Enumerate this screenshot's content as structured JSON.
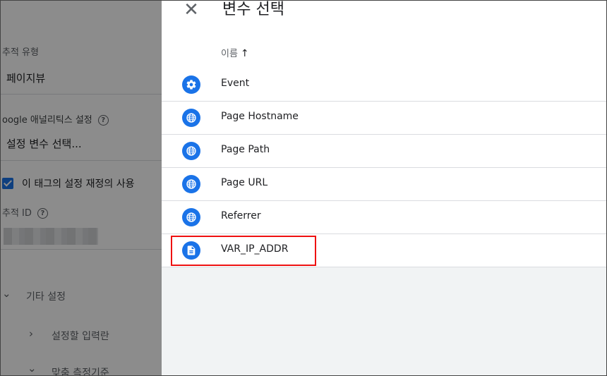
{
  "background_form": {
    "tracking_type_label": "추적 유형",
    "tracking_type_value": "페이지뷰",
    "ga_settings_label": "oogle 애널리틱스 설정",
    "select_settings_variable": "설정 변수 선택...",
    "override_checkbox_label": "이 태그의 설정 재정의 사용",
    "override_checked": true,
    "tracking_id_label": "추적 ID",
    "more_settings": "기타 설정",
    "fields_to_set": "설정할 입력란",
    "custom_dimensions": "맞춤 측정기준"
  },
  "drawer": {
    "title": "변수 선택",
    "column_header": "이름",
    "sort_indicator": "↑",
    "variables": [
      {
        "name": "Event",
        "icon": "gear-icon"
      },
      {
        "name": "Page Hostname",
        "icon": "globe-icon"
      },
      {
        "name": "Page Path",
        "icon": "globe-icon"
      },
      {
        "name": "Page URL",
        "icon": "globe-icon"
      },
      {
        "name": "Referrer",
        "icon": "globe-icon"
      },
      {
        "name": "VAR_IP_ADDR",
        "icon": "document-icon",
        "highlighted": true
      }
    ]
  },
  "colors": {
    "icon_blue": "#1a73e8",
    "highlight_red": "#ee1111"
  }
}
